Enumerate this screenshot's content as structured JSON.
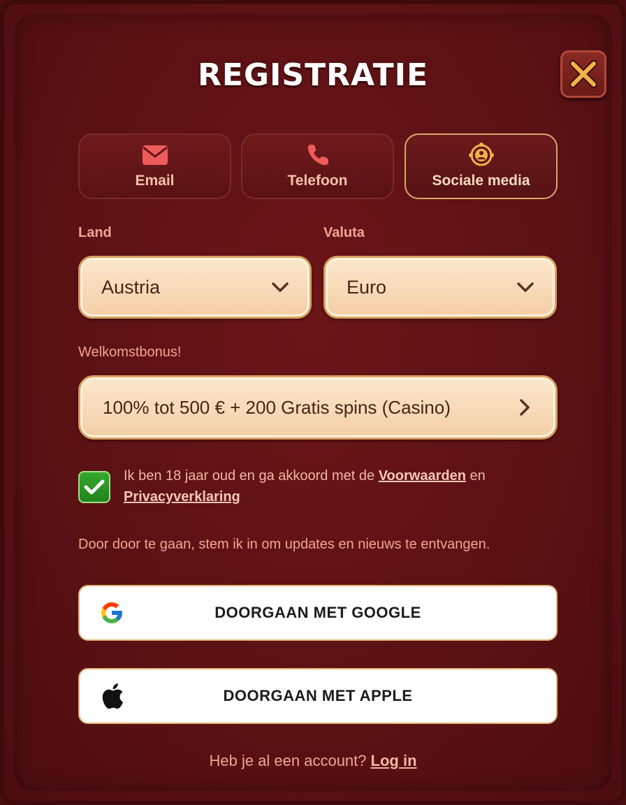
{
  "title": "REGISTRATIE",
  "close_icon": "close-icon",
  "tabs": [
    {
      "label": "Email",
      "icon": "envelope-icon",
      "active": false
    },
    {
      "label": "Telefoon",
      "icon": "phone-icon",
      "active": false
    },
    {
      "label": "Sociale media",
      "icon": "social-media-icon",
      "active": true
    }
  ],
  "country": {
    "label": "Land",
    "value": "Austria"
  },
  "currency": {
    "label": "Valuta",
    "value": "Euro"
  },
  "bonus": {
    "label": "Welkomstbonus!",
    "value": "100% tot 500 € + 200 Gratis spins (Casino)"
  },
  "consent": {
    "checked": true,
    "text_before": "Ik ben 18 jaar oud en ga akkoord met de",
    "terms_link": "Voorwaarden",
    "text_middle": "en",
    "privacy_link": "Privacyverklaring"
  },
  "updates_text": "Door door te gaan, stem ik in om updates en nieuws te entvangen.",
  "google_button": "DOORGAAN MET GOOGLE",
  "apple_button": "DOORGAAN MET APPLE",
  "footer": {
    "text": "Heb je al een account?",
    "login_link": "Log in"
  },
  "colors": {
    "background": "#5a1114",
    "accent": "#d7a160",
    "text_pink": "#f2a690",
    "check_green": "#2e9a26"
  }
}
